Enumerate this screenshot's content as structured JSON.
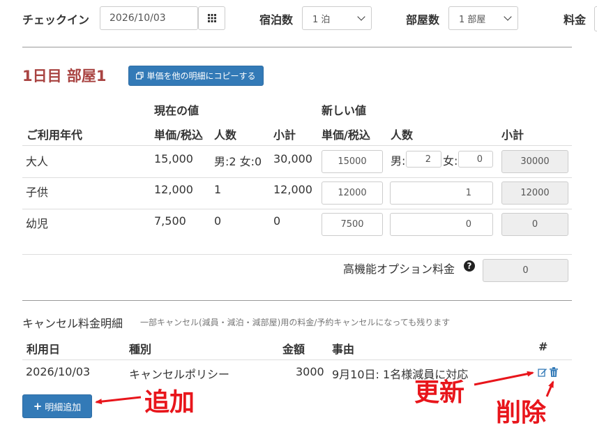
{
  "topbar": {
    "checkin_label": "チェックイン",
    "checkin_value": "2026/10/03",
    "nights_label": "宿泊数",
    "nights_value": "1 泊",
    "rooms_label": "部屋数",
    "rooms_value": "1 部屋",
    "fee_label": "料金"
  },
  "room": {
    "title": "1日目 部屋1",
    "copy_button": "単価を他の明細にコピーする",
    "current_header": "現在の値",
    "new_header": "新しい値",
    "col_age": "ご利用年代",
    "col_price": "単価/税込",
    "col_people": "人数",
    "col_subtotal": "小計",
    "col_new_price": "単価/税込",
    "col_new_people": "人数",
    "col_new_subtotal": "小計",
    "rows": [
      {
        "age": "大人",
        "price": "15,000",
        "people": "男:2 女:0",
        "subtotal": "30,000",
        "new_price": "15000",
        "male_label": "男:",
        "male_value": "2",
        "female_label": "女:",
        "female_value": "0",
        "new_subtotal": "30000"
      },
      {
        "age": "子供",
        "price": "12,000",
        "people": "1",
        "subtotal": "12,000",
        "new_price": "12000",
        "new_people": "1",
        "new_subtotal": "12000"
      },
      {
        "age": "幼児",
        "price": "7,500",
        "people": "0",
        "subtotal": "0",
        "new_price": "7500",
        "new_people": "0",
        "new_subtotal": "0"
      }
    ],
    "option_label": "高機能オプション料金",
    "option_value": "0"
  },
  "cancel": {
    "title": "キャンセル料金明細",
    "note": "一部キャンセル(減員・減泊・減部屋)用の料金/予約キャンセルになっても残ります",
    "col_date": "利用日",
    "col_type": "種別",
    "col_amount": "金額",
    "col_reason": "事由",
    "col_hash": "#",
    "rows": [
      {
        "date": "2026/10/03",
        "type": "キャンセルポリシー",
        "amount": "3000",
        "reason": "9月10日: 1名様減員に対応"
      }
    ],
    "add_button": "明細追加"
  },
  "annotations": {
    "add": "追加",
    "update": "更新",
    "delete": "削除"
  },
  "colors": {
    "primary": "#337ab7",
    "title_red": "#a94442",
    "annotation_red": "#e8151b"
  }
}
